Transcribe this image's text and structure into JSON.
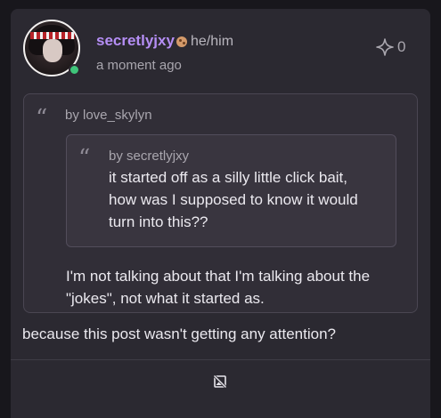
{
  "post": {
    "username": "secretlyjxy",
    "pronouns": "he/him",
    "timestamp": "a moment ago",
    "like_count": "0",
    "quote": {
      "author": "by love_skylyn",
      "nested_quote": {
        "author": "by secretlyjxy",
        "text": "it started off as a silly little click bait, how was I supposed to know it would turn into this??"
      },
      "text": "I'm not talking about that I'm talking about the \"jokes\", not what it started as."
    },
    "body": "because this post wasn't getting any attention?"
  },
  "colors": {
    "username": "#b58ef5",
    "online": "#3fc57a",
    "card_bg": "#2b2931",
    "page_bg": "#18171c"
  },
  "icons": [
    "cookie-icon",
    "sparkle-icon",
    "quote-icon",
    "no-image-icon",
    "online-status-icon"
  ]
}
